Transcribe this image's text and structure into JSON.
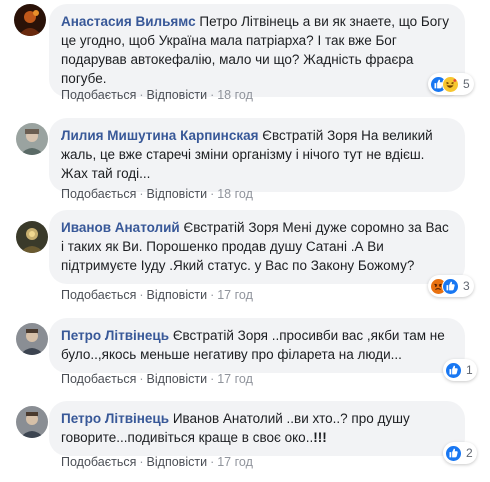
{
  "actions": {
    "like": "Подобається",
    "reply": "Відповісти",
    "separator": "·"
  },
  "comments": [
    {
      "author": "Анастасия Вильямс",
      "text": "Петро Літвінець а ви як знаете, що Богу це угодно, щоб Україна мала патріарха? І так вже Бог подарував автокефалію, мало чи що? Жадність фраєра погубе.",
      "time": "18 год",
      "reactions": {
        "icons": [
          "like-icon",
          "haha-icon"
        ],
        "count": "5"
      }
    },
    {
      "author": "Лилия Мишутина Карпинская",
      "text": "Євстратій Зоря На великий жаль, це вже старечі зміни організму і нічого тут не вдієш. Жах тай годі...",
      "time": "18 год"
    },
    {
      "author": "Иванов Анатолий",
      "text": "Євстратій Зоря Мені дуже соромно за Вас і таких як Ви. Порошенко продав душу Сатані .А Ви підтримуєте Іуду .Який статус. у Вас по Закону Божому?",
      "time": "17 год",
      "reactions": {
        "icons": [
          "angry-icon",
          "like-icon"
        ],
        "count": "3"
      }
    },
    {
      "author": "Петро Літвінець",
      "text": "Євстратій Зоря ..просивби вас ,якби там не було..,якось меньше негативу про філарета на люди...",
      "time": "17 год",
      "reactions": {
        "icons": [
          "like-icon"
        ],
        "count": "1"
      }
    },
    {
      "author": "Петро Літвінець",
      "text": "Иванов Анатолий ..ви хто..? про душу говорите...подивіться краще в своє око..",
      "emphasis": "!!!",
      "time": "17 год",
      "reactions": {
        "icons": [
          "like-icon"
        ],
        "count": "2"
      }
    }
  ]
}
